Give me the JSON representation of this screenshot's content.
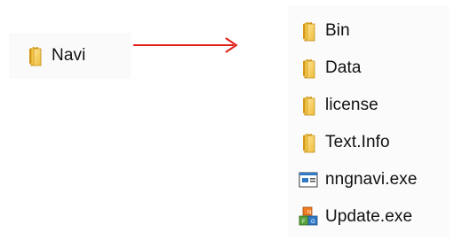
{
  "left": {
    "folder": {
      "label": "Navi",
      "icon": "folder-icon"
    }
  },
  "right": {
    "items": [
      {
        "label": "Bin",
        "icon": "folder-icon"
      },
      {
        "label": "Data",
        "icon": "folder-icon"
      },
      {
        "label": "license",
        "icon": "folder-icon"
      },
      {
        "label": "Text.Info",
        "icon": "folder-icon"
      },
      {
        "label": "nngnavi.exe",
        "icon": "exe-window-icon"
      },
      {
        "label": "Update.exe",
        "icon": "update-blocks-icon"
      }
    ]
  },
  "colors": {
    "arrow": "#e0201a",
    "folder_light": "#ffe79a",
    "folder_mid": "#f4c84a",
    "folder_dark": "#d79a18",
    "window_blue": "#2f79c7"
  }
}
